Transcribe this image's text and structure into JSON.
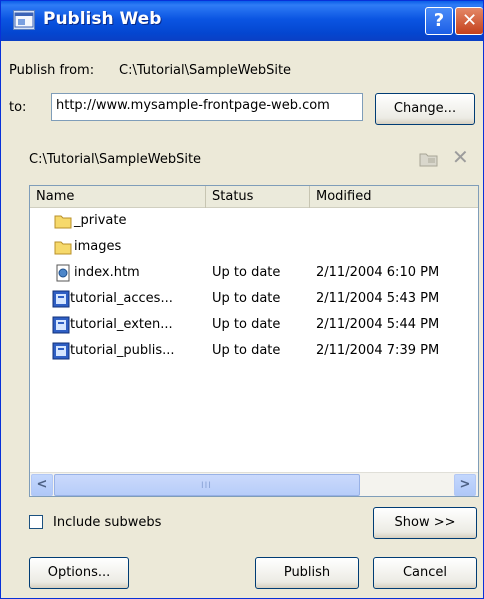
{
  "window": {
    "title": "Publish Web",
    "help_glyph": "?",
    "close_glyph": "✕"
  },
  "publish_from": {
    "label": "Publish from:",
    "value": "C:\\Tutorial\\SampleWebSite"
  },
  "publish_to": {
    "label": "to:",
    "value": "http://www.mysample-frontpage-web.com",
    "change_button": "Change..."
  },
  "file_list": {
    "path": "C:\\Tutorial\\SampleWebSite",
    "columns": [
      "Name",
      "Status",
      "Modified"
    ],
    "items": [
      {
        "name": "_private",
        "status": "",
        "modified": "",
        "icon": "folder-icon"
      },
      {
        "name": "images",
        "status": "",
        "modified": "",
        "icon": "folder-icon"
      },
      {
        "name": "index.htm",
        "status": "Up to date",
        "modified": "2/11/2004 6:10 PM",
        "icon": "html-file-icon"
      },
      {
        "name": "tutorial_acces...",
        "status": "Up to date",
        "modified": "2/11/2004 5:43 PM",
        "icon": "page-file-icon"
      },
      {
        "name": "tutorial_exten...",
        "status": "Up to date",
        "modified": "2/11/2004 5:44 PM",
        "icon": "page-file-icon"
      },
      {
        "name": "tutorial_publis...",
        "status": "Up to date",
        "modified": "2/11/2004 7:39 PM",
        "icon": "page-file-icon"
      }
    ],
    "scroll_left_glyph": "<",
    "scroll_right_glyph": ">",
    "scroll_grip": "III"
  },
  "include_subwebs": {
    "label": "Include subwebs",
    "checked": false
  },
  "buttons": {
    "show": "Show >>",
    "options": "Options...",
    "publish": "Publish",
    "cancel": "Cancel"
  },
  "colors": {
    "titlebar": "#0b55e2",
    "window_bg": "#ece9d8",
    "close_button": "#c4401c"
  }
}
